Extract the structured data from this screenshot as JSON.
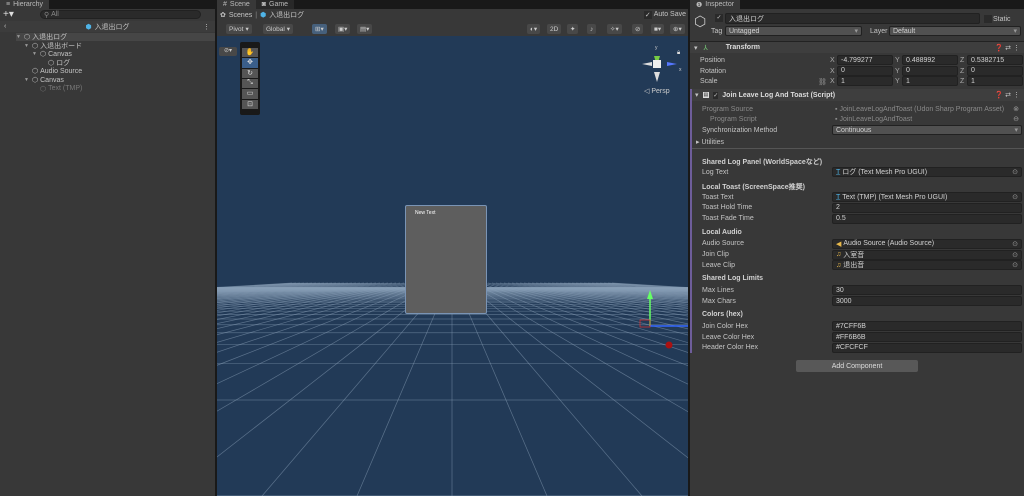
{
  "hierarchy": {
    "tab": "Hierarchy",
    "search_placeholder": "All",
    "scene_title": "入退出ログ",
    "items": [
      {
        "label": "入退出ログ",
        "depth": 0,
        "arrow": true
      },
      {
        "label": "入退出ボード",
        "depth": 1,
        "arrow": true
      },
      {
        "label": "Canvas",
        "depth": 2,
        "arrow": true
      },
      {
        "label": "ログ",
        "depth": 3,
        "arrow": false
      },
      {
        "label": "Audio Source",
        "depth": 1,
        "arrow": false
      },
      {
        "label": "Canvas",
        "depth": 1,
        "arrow": true
      },
      {
        "label": "Text (TMP)",
        "depth": 2,
        "arrow": false,
        "disabled": true
      }
    ]
  },
  "scene": {
    "tab_scene": "Scene",
    "tab_game": "Game",
    "breadcrumb_root": "Scenes",
    "breadcrumb_current": "入退出ログ",
    "auto_save": "Auto Save",
    "pivot": "Pivot",
    "global": "Global",
    "mode_2d": "2D",
    "persp": "Persp",
    "axis_y": "y",
    "axis_x": "x",
    "canvas_text": "New Text",
    "sky_color": "#223a57"
  },
  "inspector": {
    "tab": "Inspector",
    "object_name": "入退出ログ",
    "static": "Static",
    "tag_label": "Tag",
    "tag": "Untagged",
    "layer_label": "Layer",
    "layer": "Default",
    "transform": {
      "title": "Transform",
      "rows": [
        {
          "label": "Position",
          "x": "-4.799277",
          "y": "0.488992",
          "z": "0.5382715"
        },
        {
          "label": "Rotation",
          "x": "0",
          "y": "0",
          "z": "0"
        },
        {
          "label": "Scale",
          "x": "1",
          "y": "1",
          "z": "1"
        }
      ]
    },
    "script": {
      "title": "Join Leave Log And Toast (Script)",
      "program_source_label": "Program Source",
      "program_source": "JoinLeaveLogAndToast (Udon Sharp Program Asset)",
      "program_script_label": "Program Script",
      "program_script": "JoinLeaveLogAndToast",
      "sync_label": "Synchronization Method",
      "sync": "Continuous",
      "utilities": "Utilities",
      "sections": [
        {
          "header": "Shared Log Panel (WorldSpaceなど)",
          "fields": [
            {
              "label": "Log Text",
              "value": "ログ (Text Mesh Pro UGUI)",
              "icon": "tmp"
            }
          ]
        },
        {
          "header": "Local Toast (ScreenSpace推奨)",
          "fields": [
            {
              "label": "Toast Text",
              "value": "Text (TMP) (Text Mesh Pro UGUI)",
              "icon": "tmp"
            },
            {
              "label": "Toast Hold Time",
              "value": "2"
            },
            {
              "label": "Toast Fade Time",
              "value": "0.5"
            }
          ]
        },
        {
          "header": "Local Audio",
          "fields": [
            {
              "label": "Audio Source",
              "value": "Audio Source (Audio Source)",
              "icon": "audio"
            },
            {
              "label": "Join Clip",
              "value": "入室音",
              "icon": "clip"
            },
            {
              "label": "Leave Clip",
              "value": "退出音",
              "icon": "clip"
            }
          ]
        },
        {
          "header": "Shared Log Limits",
          "fields": [
            {
              "label": "Max Lines",
              "value": "30"
            },
            {
              "label": "Max Chars",
              "value": "3000"
            }
          ]
        },
        {
          "header": "Colors (hex)",
          "fields": [
            {
              "label": "Join Color Hex",
              "value": "#7CFF6B"
            },
            {
              "label": "Leave Color Hex",
              "value": "#FF6B6B"
            },
            {
              "label": "Header Color Hex",
              "value": "#CFCFCF"
            }
          ]
        }
      ]
    },
    "add_component": "Add Component"
  }
}
